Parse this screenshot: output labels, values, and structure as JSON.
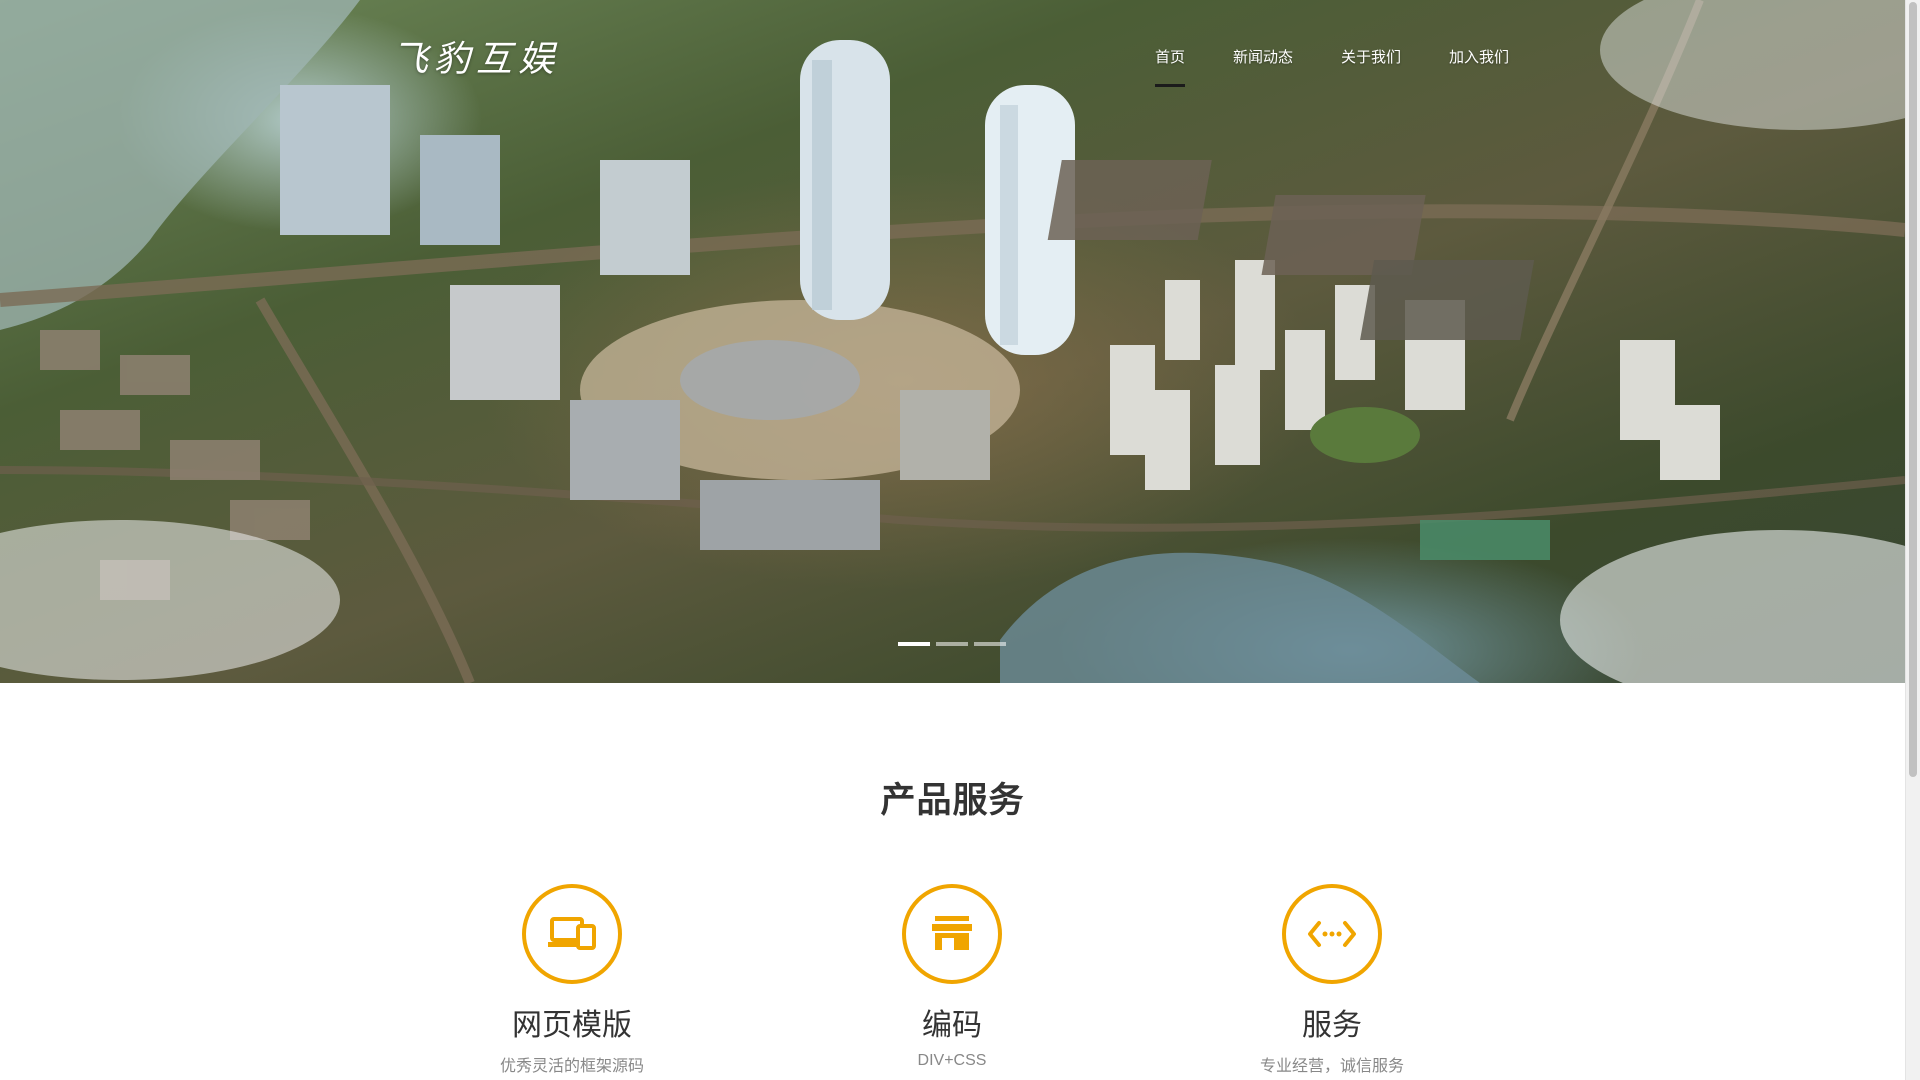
{
  "header": {
    "logo_text": "飞豹互娱",
    "nav": [
      {
        "label": "首页",
        "active": true
      },
      {
        "label": "新闻动态",
        "active": false
      },
      {
        "label": "关于我们",
        "active": false
      },
      {
        "label": "加入我们",
        "active": false
      }
    ]
  },
  "hero": {
    "image_subject": "aerial city skyline rendering",
    "slides_count": 3,
    "active_slide_index": 0
  },
  "section": {
    "title": "产品服务",
    "services": [
      {
        "icon": "devices-icon",
        "title": "网页模版",
        "subtitle": "优秀灵活的框架源码"
      },
      {
        "icon": "store-icon",
        "title": "编码",
        "subtitle": "DIV+CSS"
      },
      {
        "icon": "code-arrows-icon",
        "title": "服务",
        "subtitle": "专业经营，诚信服务"
      }
    ]
  },
  "colors": {
    "accent": "#f0a500",
    "nav_active_underline": "#1b1b1b",
    "title_text": "#333333",
    "subtitle_text": "#888888"
  }
}
